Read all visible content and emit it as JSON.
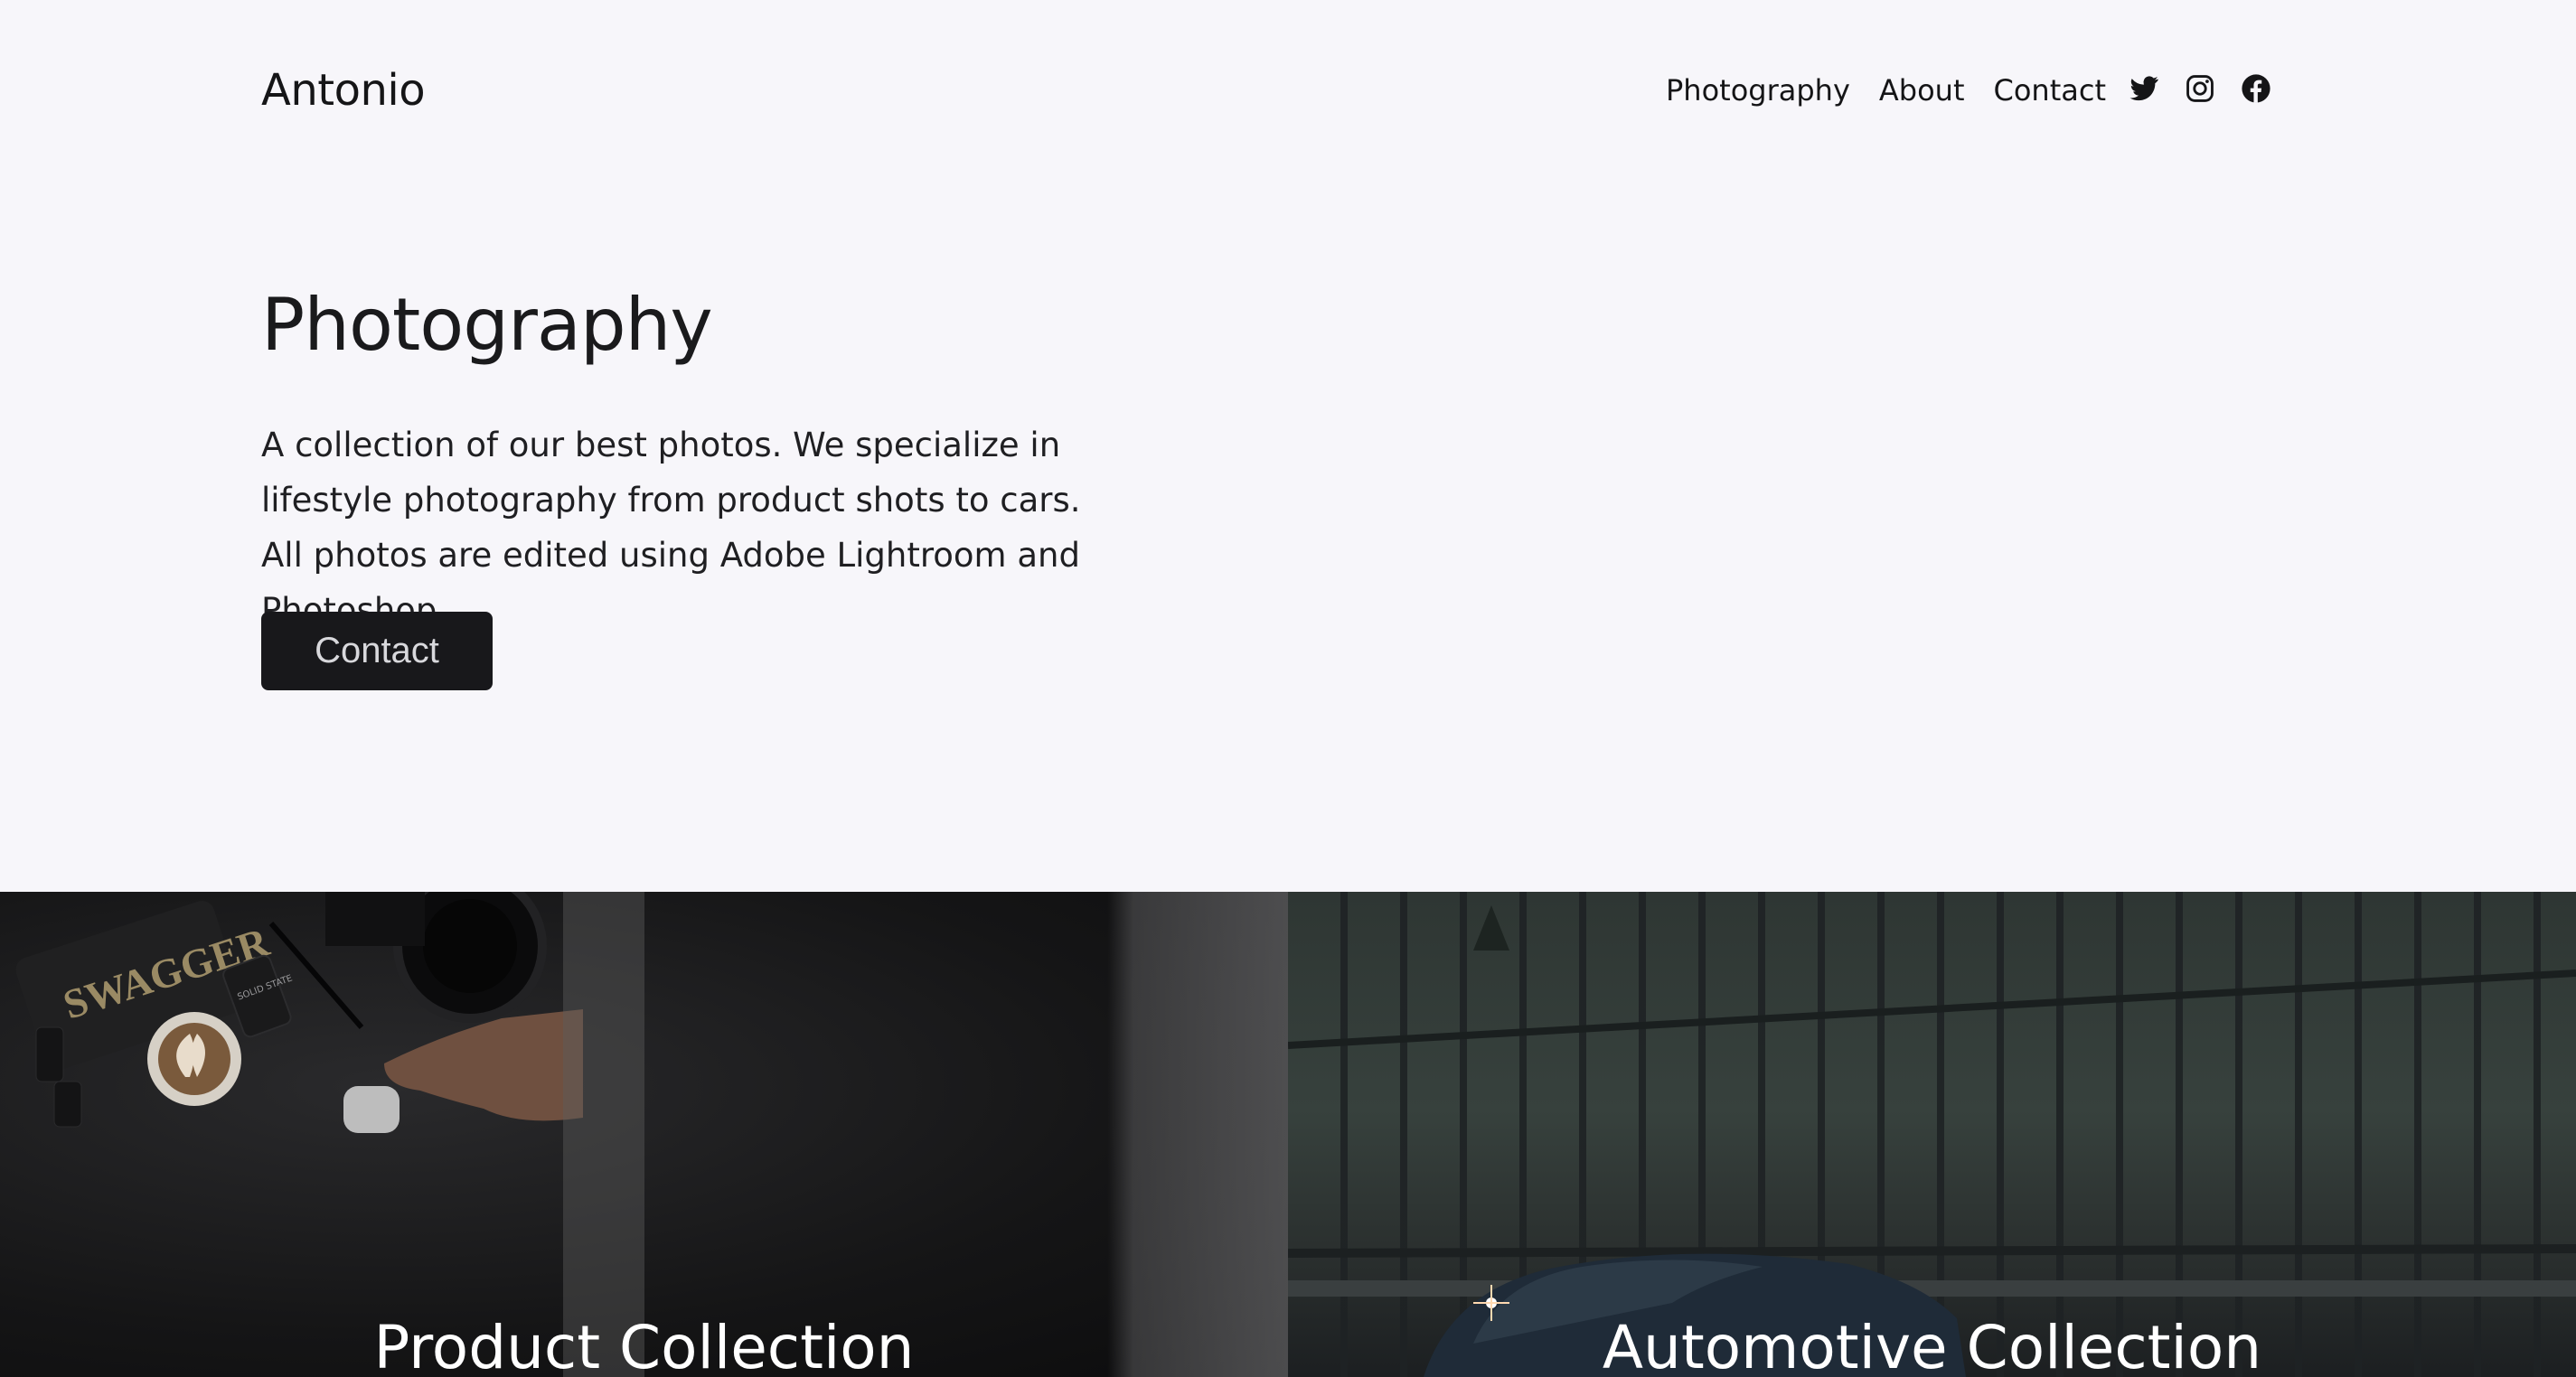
{
  "header": {
    "brand": "Antonio",
    "nav": [
      {
        "label": "Photography"
      },
      {
        "label": "About"
      },
      {
        "label": "Contact"
      }
    ],
    "social_icons": [
      "twitter-icon",
      "instagram-icon",
      "facebook-icon"
    ]
  },
  "hero": {
    "title": "Photography",
    "description": "A collection of our best photos. We specialize in lifestyle photography from product shots to cars. All photos are edited using Adobe Lightroom and Photoshop.",
    "button_label": "Contact"
  },
  "collections": [
    {
      "title": "Product Collection"
    },
    {
      "title": "Automotive Collection"
    }
  ],
  "photo_labels": {
    "product_can": "SWAGGER",
    "product_card": "SOLID STATE"
  },
  "colors": {
    "background": "#f7f6fa",
    "text": "#1a1a1c",
    "button_bg": "#18181b",
    "button_text": "#d8d8dc"
  }
}
